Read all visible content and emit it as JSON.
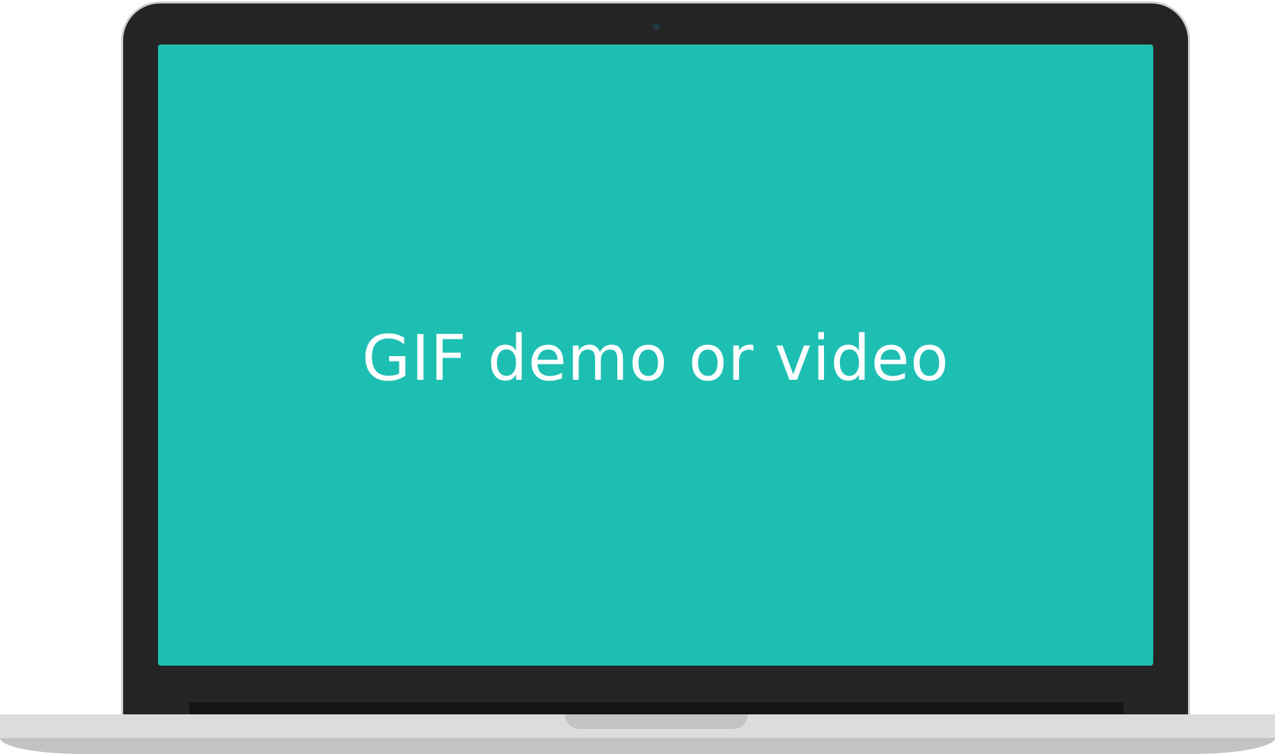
{
  "screen": {
    "text": "GIF demo or video",
    "background_color": "#1ebfb3",
    "text_color": "#ffffff"
  },
  "device": {
    "type": "laptop",
    "bezel_color": "#242424",
    "base_color": "#dcdcdc"
  }
}
